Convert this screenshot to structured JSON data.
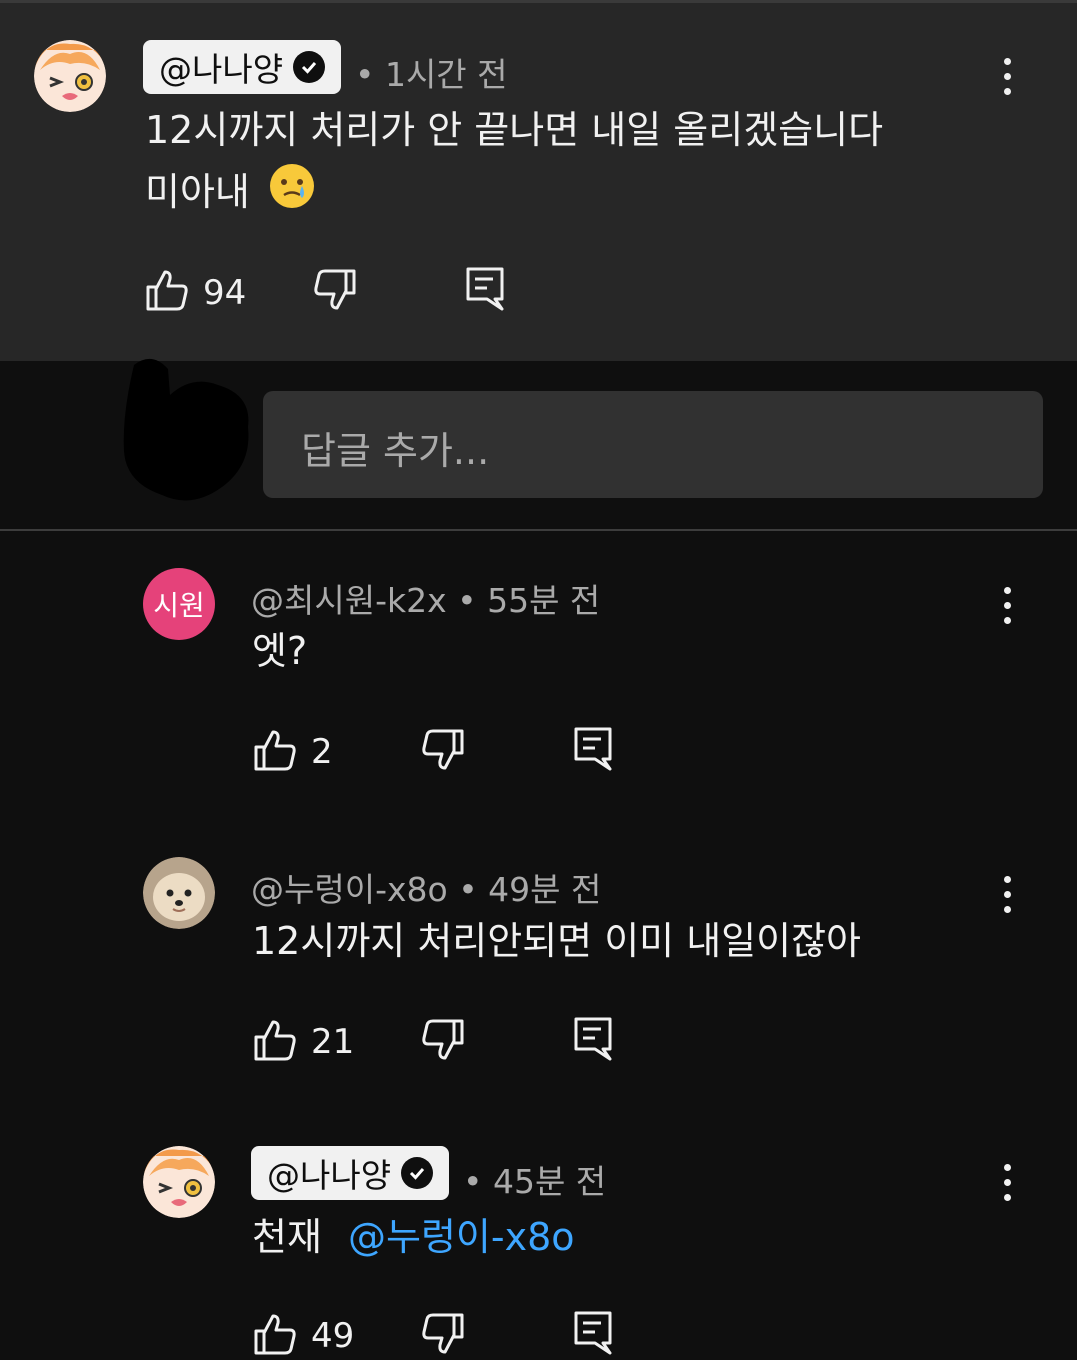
{
  "main_comment": {
    "author": "@나나양",
    "verified": true,
    "time": "• 1시간 전",
    "text_line1": "12시까지 처리가 안 끝나면 내일 올리겠습니다",
    "text_line2": "미아내",
    "emoji": "🥲",
    "likes": "94"
  },
  "reply_input": {
    "placeholder": "답글 추가..."
  },
  "replies": [
    {
      "author": "@최시원-k2x",
      "time": "• 55분 전",
      "avatar_text": "시원",
      "avatar_color": "#e5427a",
      "text": "엣?",
      "likes": "2"
    },
    {
      "author": "@누렁이-x8o",
      "time": "• 49분 전",
      "text": "12시까지 처리안되면 이미 내일이잖아",
      "likes": "21"
    },
    {
      "author": "@나나양",
      "verified": true,
      "time": "• 45분 전",
      "text": "천재",
      "mention": "@누렁이-x8o",
      "likes": "49"
    }
  ],
  "icons": {
    "like": "thumbs-up-icon",
    "dislike": "thumbs-down-icon",
    "reply": "comment-icon",
    "menu": "more-vertical-icon",
    "verified": "check-circle-icon"
  },
  "colors": {
    "background": "#0f0f0f",
    "highlight_block": "#272727",
    "mention": "#3ea6ff"
  }
}
